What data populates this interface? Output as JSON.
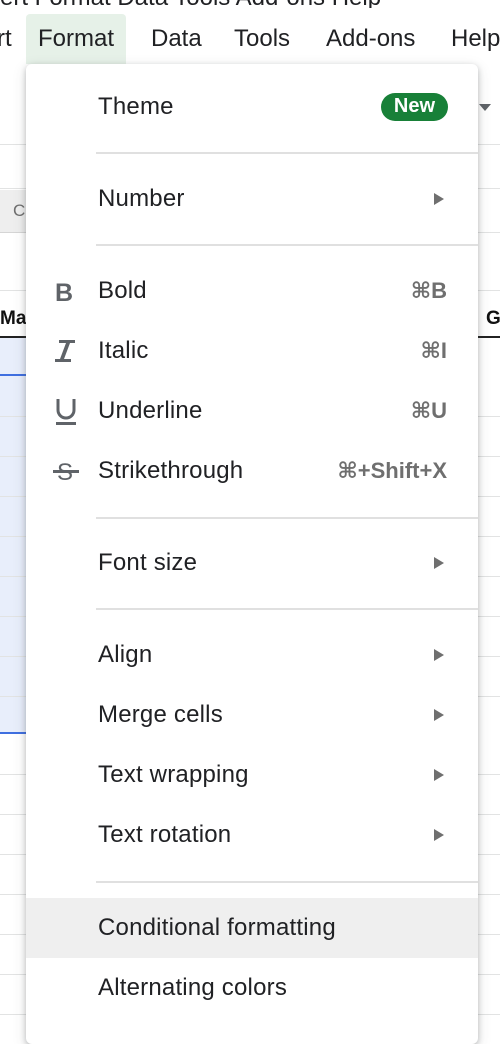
{
  "top_cut_text": "ert Format Data Tools Add-ons Help",
  "menubar": {
    "items": [
      {
        "label": "rt"
      },
      {
        "label": "Format"
      },
      {
        "label": "Data"
      },
      {
        "label": "Tools"
      },
      {
        "label": "Add-ons"
      },
      {
        "label": "Help"
      }
    ]
  },
  "sheet": {
    "name_box_text": "C",
    "col_header_left": "Ma",
    "col_header_right": "G"
  },
  "format_menu": {
    "theme": {
      "label": "Theme",
      "badge": "New"
    },
    "number": {
      "label": "Number"
    },
    "bold": {
      "label": "Bold",
      "shortcut": "⌘B",
      "icon": "bold-icon"
    },
    "italic": {
      "label": "Italic",
      "shortcut": "⌘I",
      "icon": "italic-icon"
    },
    "underline": {
      "label": "Underline",
      "shortcut": "⌘U",
      "icon": "underline-icon"
    },
    "strikethrough": {
      "label": "Strikethrough",
      "shortcut": "⌘+Shift+X",
      "icon": "strikethrough-icon"
    },
    "font_size": {
      "label": "Font size"
    },
    "align": {
      "label": "Align"
    },
    "merge_cells": {
      "label": "Merge cells"
    },
    "text_wrapping": {
      "label": "Text wrapping"
    },
    "text_rotation": {
      "label": "Text rotation"
    },
    "conditional_formatting": {
      "label": "Conditional formatting"
    },
    "alternating_colors": {
      "label": "Alternating colors"
    }
  },
  "colors": {
    "badge_green": "#188038",
    "active_menu_bg": "#e6f1e8",
    "hover_bg": "#efefef",
    "selection_blue": "#3f6fe0",
    "selection_fill": "#e8eefb"
  }
}
